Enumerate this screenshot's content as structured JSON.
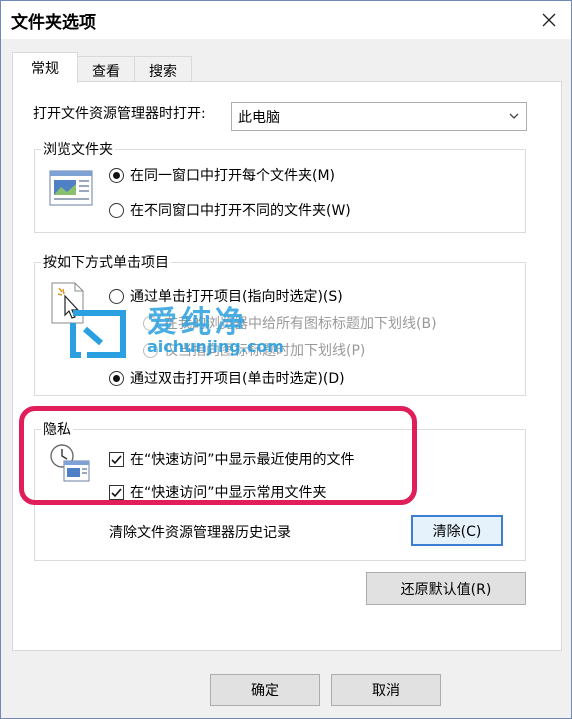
{
  "window": {
    "title": "文件夹选项"
  },
  "tabs": [
    {
      "label": "常规",
      "active": true
    },
    {
      "label": "查看",
      "active": false
    },
    {
      "label": "搜索",
      "active": false
    }
  ],
  "open_explorer": {
    "label": "打开文件资源管理器时打开:",
    "value": "此电脑"
  },
  "browse": {
    "title": "浏览文件夹",
    "options": [
      {
        "label": "在同一窗口中打开每个文件夹(M)",
        "checked": true
      },
      {
        "label": "在不同窗口中打开不同的文件夹(W)",
        "checked": false
      }
    ]
  },
  "click": {
    "title": "按如下方式单击项目",
    "single": "通过单击打开项目(指向时选定)(S)",
    "sub1": "在我的浏览器中给所有图标标题加下划线(B)",
    "sub2": "仅当指向图标标题时加下划线(P)",
    "double": "通过双击打开项目(单击时选定)(D)"
  },
  "privacy": {
    "title": "隐私",
    "recent": "在“快速访问”中显示最近使用的文件",
    "frequent": "在“快速访问”中显示常用文件夹",
    "clear_label": "清除文件资源管理器历史记录",
    "clear_button": "清除(C)"
  },
  "restore_button": "还原默认值(R)",
  "ok_button": "确定",
  "cancel_button": "取消",
  "watermark": {
    "text": "爱纯净",
    "url": "aichunjing.com"
  },
  "colors": {
    "highlight": "#e01e5a",
    "focus": "#3c7fd1",
    "watermark": "#2aa0e0"
  }
}
